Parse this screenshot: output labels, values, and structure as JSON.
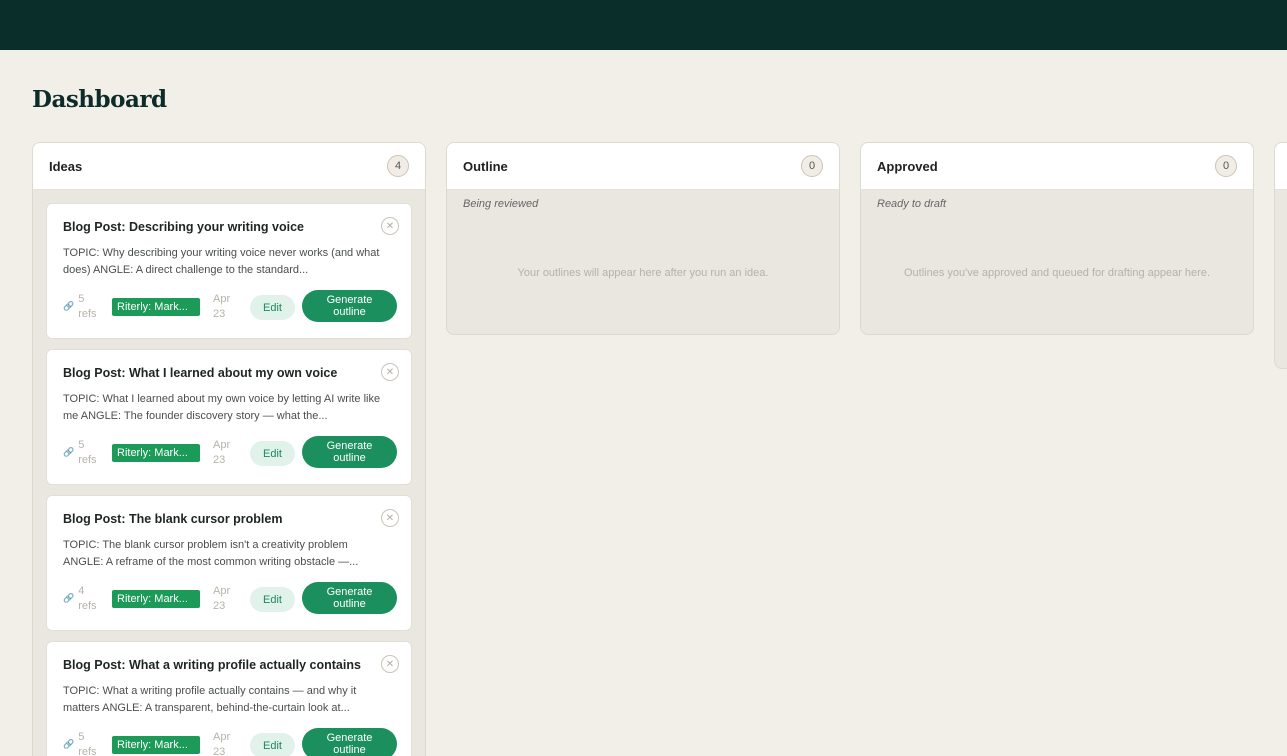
{
  "page": {
    "title": "Dashboard"
  },
  "columns": [
    {
      "title": "Ideas",
      "count": "4",
      "subtitle": "",
      "empty_text": "",
      "cards": [
        {
          "title": "Blog Post: Describing your writing voice",
          "description": "TOPIC: Why describing your writing voice never works (and what does) ANGLE: A direct challenge to the standard...",
          "refs_count": "5",
          "refs_label": "refs",
          "tag": "Riterly: Mark...",
          "date_month": "Apr",
          "date_day": "23",
          "edit_label": "Edit",
          "generate_label": "Generate outline"
        },
        {
          "title": "Blog Post: What I learned about my own voice",
          "description": "TOPIC: What I learned about my own voice by letting AI write like me ANGLE: The founder discovery story — what the...",
          "refs_count": "5",
          "refs_label": "refs",
          "tag": "Riterly: Mark...",
          "date_month": "Apr",
          "date_day": "23",
          "edit_label": "Edit",
          "generate_label": "Generate outline"
        },
        {
          "title": "Blog Post: The blank cursor problem",
          "description": "TOPIC: The blank cursor problem isn't a creativity problem ANGLE: A reframe of the most common writing obstacle —...",
          "refs_count": "4",
          "refs_label": "refs",
          "tag": "Riterly: Mark...",
          "date_month": "Apr",
          "date_day": "23",
          "edit_label": "Edit",
          "generate_label": "Generate outline"
        },
        {
          "title": "Blog Post: What a writing profile actually contains",
          "description": "TOPIC: What a writing profile actually contains — and why it matters ANGLE: A transparent, behind-the-curtain look at...",
          "refs_count": "5",
          "refs_label": "refs",
          "tag": "Riterly: Mark...",
          "date_month": "Apr",
          "date_day": "23",
          "edit_label": "Edit",
          "generate_label": "Generate outline"
        }
      ]
    },
    {
      "title": "Outline",
      "count": "0",
      "subtitle": "Being reviewed",
      "empty_text": "Your outlines will appear here after you run an idea."
    },
    {
      "title": "Approved",
      "count": "0",
      "subtitle": "Ready to draft",
      "empty_text": "Outlines you've approved and queued for drafting appear here."
    }
  ],
  "icons": {
    "close": "close-icon",
    "link": "link-icon"
  },
  "colors": {
    "topbar": "#0a2e2a",
    "accent": "#1c8f5e",
    "tag": "#1c9a57",
    "background": "#f2efe9"
  }
}
